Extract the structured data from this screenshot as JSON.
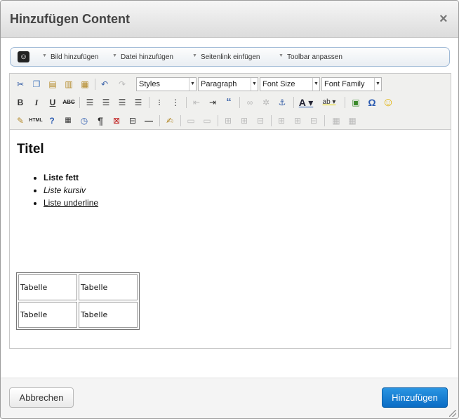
{
  "dialog": {
    "title": "Hinzufügen Content",
    "close_glyph": "×"
  },
  "plugin_toolbar": {
    "logo_glyph": "☺",
    "items": [
      {
        "label": "Bild hinzufügen"
      },
      {
        "label": "Datei hinzufügen"
      },
      {
        "label": "Seitenlink einfügen"
      },
      {
        "label": "Toolbar anpassen"
      }
    ]
  },
  "editor_toolbar": {
    "styles": "Styles",
    "format": "Paragraph",
    "font_size": "Font Size",
    "font_family": "Font Family",
    "icons_row1": [
      "cut-icon",
      "copy-icon",
      "paste-icon",
      "paste-text-icon",
      "paste-word-icon",
      "undo-icon",
      "redo-icon"
    ],
    "icons_row2": [
      "bold-icon",
      "italic-icon",
      "underline-icon",
      "strikethrough-icon",
      "align-left-icon",
      "align-center-icon",
      "align-right-icon",
      "align-justify-icon",
      "bullet-list-icon",
      "numbered-list-icon",
      "outdent-icon",
      "indent-icon",
      "blockquote-icon",
      "link-icon",
      "unlink-icon",
      "anchor-icon",
      "text-color-icon",
      "highlight-color-icon",
      "image-icon",
      "special-char-icon",
      "emoticon-icon"
    ],
    "icons_row3": [
      "clean-icon",
      "html-icon",
      "help-icon",
      "insert-date-icon",
      "insert-time-icon",
      "show-blocks-icon",
      "remove-format-icon",
      "page-break-icon",
      "horizontal-rule-icon",
      "edit-icon",
      "table-icon",
      "row-icon",
      "insert-col-icon",
      "delete-col-icon",
      "cell-icon"
    ]
  },
  "content": {
    "heading": "Titel",
    "list": [
      "Liste fett",
      "Liste kursiv",
      "Liste underline"
    ],
    "table": [
      [
        "Tabelle",
        "Tabelle"
      ],
      [
        "Tabelle",
        "Tabelle"
      ]
    ]
  },
  "footer": {
    "cancel_label": "Abbrechen",
    "add_label": "Hinzufügen"
  }
}
